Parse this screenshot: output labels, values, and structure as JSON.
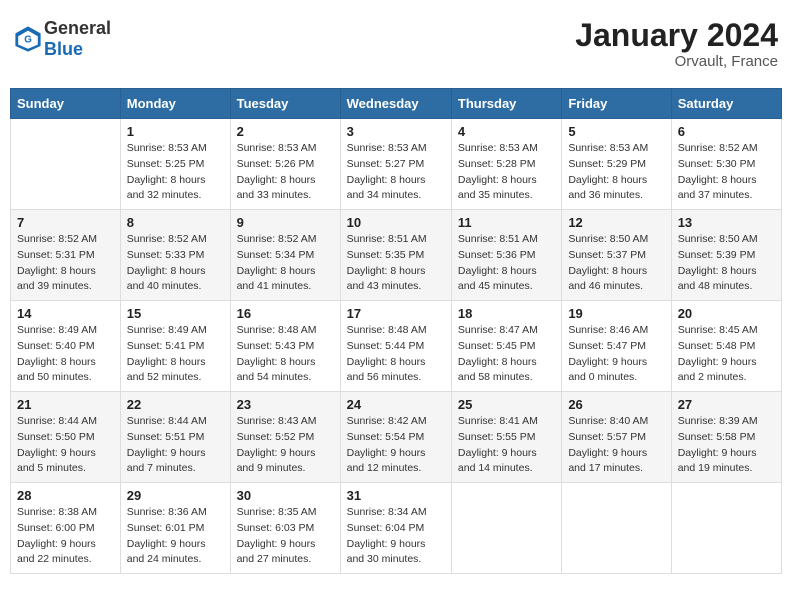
{
  "header": {
    "logo_general": "General",
    "logo_blue": "Blue",
    "month": "January 2024",
    "location": "Orvault, France"
  },
  "days_of_week": [
    "Sunday",
    "Monday",
    "Tuesday",
    "Wednesday",
    "Thursday",
    "Friday",
    "Saturday"
  ],
  "weeks": [
    [
      {
        "day": "",
        "sunrise": "",
        "sunset": "",
        "daylight": ""
      },
      {
        "day": "1",
        "sunrise": "Sunrise: 8:53 AM",
        "sunset": "Sunset: 5:25 PM",
        "daylight": "Daylight: 8 hours and 32 minutes."
      },
      {
        "day": "2",
        "sunrise": "Sunrise: 8:53 AM",
        "sunset": "Sunset: 5:26 PM",
        "daylight": "Daylight: 8 hours and 33 minutes."
      },
      {
        "day": "3",
        "sunrise": "Sunrise: 8:53 AM",
        "sunset": "Sunset: 5:27 PM",
        "daylight": "Daylight: 8 hours and 34 minutes."
      },
      {
        "day": "4",
        "sunrise": "Sunrise: 8:53 AM",
        "sunset": "Sunset: 5:28 PM",
        "daylight": "Daylight: 8 hours and 35 minutes."
      },
      {
        "day": "5",
        "sunrise": "Sunrise: 8:53 AM",
        "sunset": "Sunset: 5:29 PM",
        "daylight": "Daylight: 8 hours and 36 minutes."
      },
      {
        "day": "6",
        "sunrise": "Sunrise: 8:52 AM",
        "sunset": "Sunset: 5:30 PM",
        "daylight": "Daylight: 8 hours and 37 minutes."
      }
    ],
    [
      {
        "day": "7",
        "sunrise": "Sunrise: 8:52 AM",
        "sunset": "Sunset: 5:31 PM",
        "daylight": "Daylight: 8 hours and 39 minutes."
      },
      {
        "day": "8",
        "sunrise": "Sunrise: 8:52 AM",
        "sunset": "Sunset: 5:33 PM",
        "daylight": "Daylight: 8 hours and 40 minutes."
      },
      {
        "day": "9",
        "sunrise": "Sunrise: 8:52 AM",
        "sunset": "Sunset: 5:34 PM",
        "daylight": "Daylight: 8 hours and 41 minutes."
      },
      {
        "day": "10",
        "sunrise": "Sunrise: 8:51 AM",
        "sunset": "Sunset: 5:35 PM",
        "daylight": "Daylight: 8 hours and 43 minutes."
      },
      {
        "day": "11",
        "sunrise": "Sunrise: 8:51 AM",
        "sunset": "Sunset: 5:36 PM",
        "daylight": "Daylight: 8 hours and 45 minutes."
      },
      {
        "day": "12",
        "sunrise": "Sunrise: 8:50 AM",
        "sunset": "Sunset: 5:37 PM",
        "daylight": "Daylight: 8 hours and 46 minutes."
      },
      {
        "day": "13",
        "sunrise": "Sunrise: 8:50 AM",
        "sunset": "Sunset: 5:39 PM",
        "daylight": "Daylight: 8 hours and 48 minutes."
      }
    ],
    [
      {
        "day": "14",
        "sunrise": "Sunrise: 8:49 AM",
        "sunset": "Sunset: 5:40 PM",
        "daylight": "Daylight: 8 hours and 50 minutes."
      },
      {
        "day": "15",
        "sunrise": "Sunrise: 8:49 AM",
        "sunset": "Sunset: 5:41 PM",
        "daylight": "Daylight: 8 hours and 52 minutes."
      },
      {
        "day": "16",
        "sunrise": "Sunrise: 8:48 AM",
        "sunset": "Sunset: 5:43 PM",
        "daylight": "Daylight: 8 hours and 54 minutes."
      },
      {
        "day": "17",
        "sunrise": "Sunrise: 8:48 AM",
        "sunset": "Sunset: 5:44 PM",
        "daylight": "Daylight: 8 hours and 56 minutes."
      },
      {
        "day": "18",
        "sunrise": "Sunrise: 8:47 AM",
        "sunset": "Sunset: 5:45 PM",
        "daylight": "Daylight: 8 hours and 58 minutes."
      },
      {
        "day": "19",
        "sunrise": "Sunrise: 8:46 AM",
        "sunset": "Sunset: 5:47 PM",
        "daylight": "Daylight: 9 hours and 0 minutes."
      },
      {
        "day": "20",
        "sunrise": "Sunrise: 8:45 AM",
        "sunset": "Sunset: 5:48 PM",
        "daylight": "Daylight: 9 hours and 2 minutes."
      }
    ],
    [
      {
        "day": "21",
        "sunrise": "Sunrise: 8:44 AM",
        "sunset": "Sunset: 5:50 PM",
        "daylight": "Daylight: 9 hours and 5 minutes."
      },
      {
        "day": "22",
        "sunrise": "Sunrise: 8:44 AM",
        "sunset": "Sunset: 5:51 PM",
        "daylight": "Daylight: 9 hours and 7 minutes."
      },
      {
        "day": "23",
        "sunrise": "Sunrise: 8:43 AM",
        "sunset": "Sunset: 5:52 PM",
        "daylight": "Daylight: 9 hours and 9 minutes."
      },
      {
        "day": "24",
        "sunrise": "Sunrise: 8:42 AM",
        "sunset": "Sunset: 5:54 PM",
        "daylight": "Daylight: 9 hours and 12 minutes."
      },
      {
        "day": "25",
        "sunrise": "Sunrise: 8:41 AM",
        "sunset": "Sunset: 5:55 PM",
        "daylight": "Daylight: 9 hours and 14 minutes."
      },
      {
        "day": "26",
        "sunrise": "Sunrise: 8:40 AM",
        "sunset": "Sunset: 5:57 PM",
        "daylight": "Daylight: 9 hours and 17 minutes."
      },
      {
        "day": "27",
        "sunrise": "Sunrise: 8:39 AM",
        "sunset": "Sunset: 5:58 PM",
        "daylight": "Daylight: 9 hours and 19 minutes."
      }
    ],
    [
      {
        "day": "28",
        "sunrise": "Sunrise: 8:38 AM",
        "sunset": "Sunset: 6:00 PM",
        "daylight": "Daylight: 9 hours and 22 minutes."
      },
      {
        "day": "29",
        "sunrise": "Sunrise: 8:36 AM",
        "sunset": "Sunset: 6:01 PM",
        "daylight": "Daylight: 9 hours and 24 minutes."
      },
      {
        "day": "30",
        "sunrise": "Sunrise: 8:35 AM",
        "sunset": "Sunset: 6:03 PM",
        "daylight": "Daylight: 9 hours and 27 minutes."
      },
      {
        "day": "31",
        "sunrise": "Sunrise: 8:34 AM",
        "sunset": "Sunset: 6:04 PM",
        "daylight": "Daylight: 9 hours and 30 minutes."
      },
      {
        "day": "",
        "sunrise": "",
        "sunset": "",
        "daylight": ""
      },
      {
        "day": "",
        "sunrise": "",
        "sunset": "",
        "daylight": ""
      },
      {
        "day": "",
        "sunrise": "",
        "sunset": "",
        "daylight": ""
      }
    ]
  ]
}
